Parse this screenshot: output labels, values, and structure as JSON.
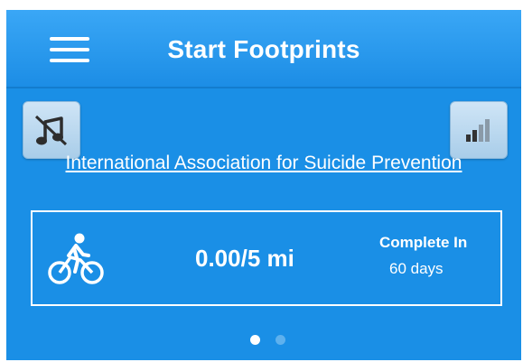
{
  "navbar": {
    "title": "Start Footprints",
    "menu_icon": "hamburger-menu-icon"
  },
  "controls": {
    "music_icon": "music-muted-icon",
    "signal_icon": "signal-strength-icon"
  },
  "organization": {
    "link_text": "International Association for Suicide Prevention"
  },
  "activity_card": {
    "icon": "bicycle-icon",
    "distance": "0.00/5 mi",
    "complete_label": "Complete In",
    "complete_value": "60 days"
  },
  "pager": {
    "pages": 2,
    "active_index": 0
  },
  "colors": {
    "background": "#1a8fe6",
    "navbar": "#2c9bef",
    "text": "#ffffff",
    "button_bg": "#bcd9ef",
    "inactive_dot": "#5eb1ee"
  }
}
